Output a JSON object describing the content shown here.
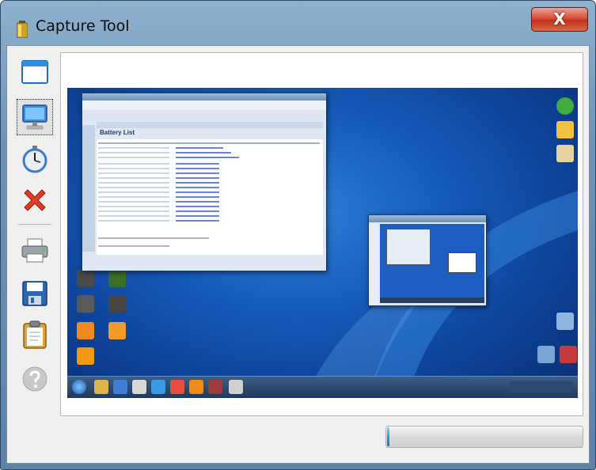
{
  "window": {
    "title": "Capture Tool",
    "close_glyph": "X"
  },
  "toolbar": {
    "buttons": [
      {
        "name": "window-capture-button",
        "icon": "window-icon",
        "selected": false
      },
      {
        "name": "screen-capture-button",
        "icon": "monitor-icon",
        "selected": true
      },
      {
        "name": "timer-button",
        "icon": "stopwatch-icon",
        "selected": false
      },
      {
        "name": "cancel-button",
        "icon": "red-x-icon",
        "selected": false
      },
      {
        "name": "print-button",
        "icon": "printer-icon",
        "selected": false
      },
      {
        "name": "save-button",
        "icon": "floppy-disk-icon",
        "selected": false
      },
      {
        "name": "copy-to-clipboard-button",
        "icon": "clipboard-icon",
        "selected": false
      },
      {
        "name": "help-button",
        "icon": "help-icon",
        "selected": false
      }
    ]
  },
  "preview": {
    "inner_app_title": "Battery List"
  },
  "progress": {
    "value": 0.01
  },
  "colors": {
    "frame": "#6f93b6",
    "close_button": "#d8503c",
    "desktop": "#1458b8",
    "progress_fill": "#2a9be0"
  }
}
